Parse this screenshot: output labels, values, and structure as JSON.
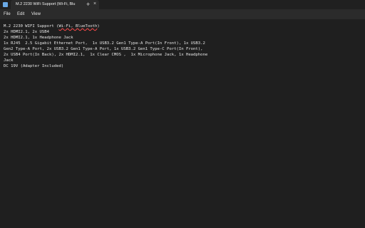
{
  "window": {
    "tab_title": "M.2 2230 WiFi Support (Wi-Fi, Blu",
    "tab_close": "×",
    "new_tab": "+",
    "app_icon": "notepad-icon"
  },
  "menu": {
    "items": [
      "File",
      "Edit",
      "View"
    ]
  },
  "editor": {
    "line1_prefix": "M.2 2230 WIFI Support (",
    "line1_flagged": "Wi-Fi, BlueTooth",
    "line1_suffix": ")",
    "lines": [
      "2x HDMI2.1, 2x USB4",
      "2x HDMI2.1, 1x Headphone Jack",
      "1x RJ45  2.5 Gigabit Ethernet Port,  1x USB3.2 Gen1 Type-A Port(In Front), 1x USB3.2",
      "Gen2 Type-A Port, 2x USB3.2 Gen1 Type-A Port, 1x USB3.2 Gen1 Type-C Port(In Front),",
      "2x USB4 Port(In Back), 2x HDMI2.1,  1x Clear CMOS ,  1x Microphone Jack, 1x Headphone",
      "Jack",
      "DC 19V (Adapter Included)"
    ]
  },
  "colors": {
    "background": "#1f1f1f",
    "chrome": "#2b2b2b",
    "text": "#e6e6e6",
    "spellcheck": "#ff4b4b"
  }
}
